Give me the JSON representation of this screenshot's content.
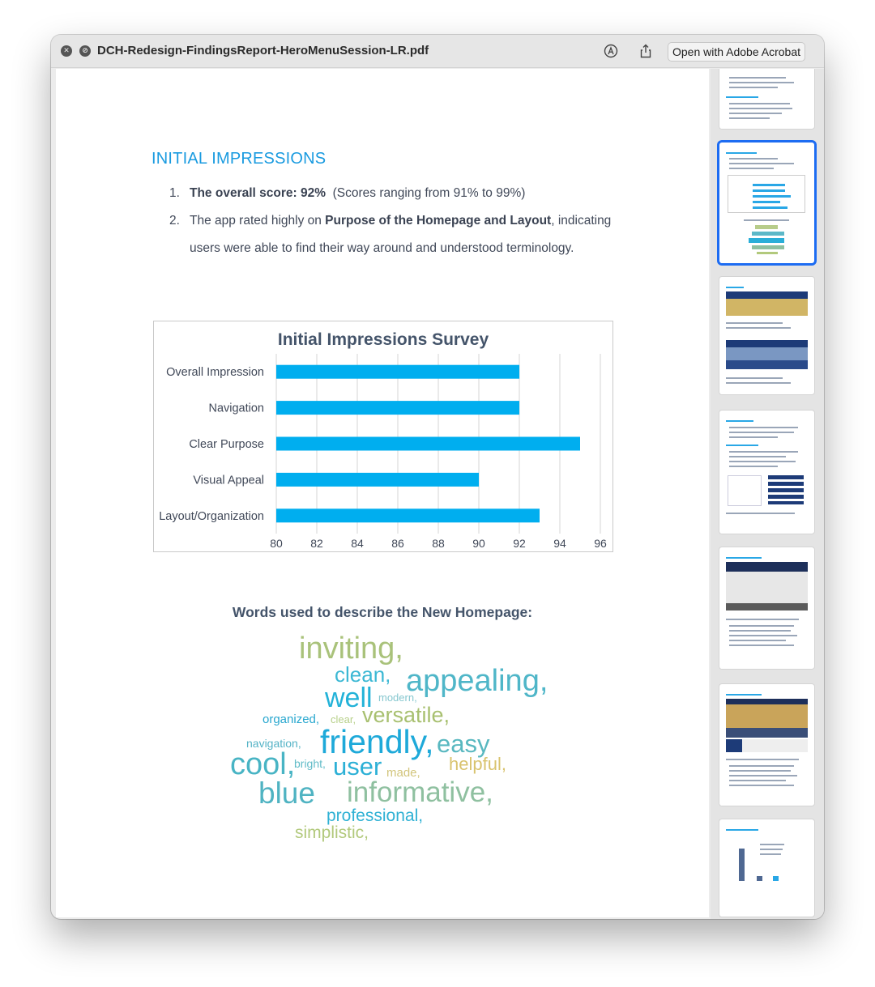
{
  "window": {
    "title": "DCH-Redesign-FindingsReport-HeroMenuSession-LR.pdf",
    "open_button_label": "Open with Adobe Acrobat"
  },
  "document": {
    "section_title": "INITIAL IMPRESSIONS",
    "list": [
      {
        "num": "1.",
        "bold": "The overall score: 92%",
        "rest": "  (Scores ranging from 91% to 99%)"
      },
      {
        "num": "2.",
        "pre": "The app rated highly on ",
        "bold": "Purpose of the Homepage and Layout",
        "post": ", indicating users were able to find their way around and understood terminology."
      }
    ],
    "wordcloud_title": "Words used to describe the New Homepage:",
    "wordcloud": [
      {
        "text": "inviting,",
        "color": "#a9c27a"
      },
      {
        "text": "clean,",
        "color": "#3cb8d4"
      },
      {
        "text": "appealing,",
        "color": "#4fb6c8"
      },
      {
        "text": "well",
        "color": "#22b2d8"
      },
      {
        "text": "modern,",
        "color": "#86c7cf"
      },
      {
        "text": "organized,",
        "color": "#28a7cf"
      },
      {
        "text": "clear,",
        "color": "#b7d08a"
      },
      {
        "text": "versatile,",
        "color": "#a8c070"
      },
      {
        "text": "navigation,",
        "color": "#55b3c6"
      },
      {
        "text": "friendly,",
        "color": "#1ea9d9"
      },
      {
        "text": "easy",
        "color": "#59b8c0"
      },
      {
        "text": "cool,",
        "color": "#48b4c4"
      },
      {
        "text": "bright,",
        "color": "#62bcc8"
      },
      {
        "text": "user",
        "color": "#2cb0d6"
      },
      {
        "text": "made,",
        "color": "#d2c57c"
      },
      {
        "text": "helpful,",
        "color": "#d9c36e"
      },
      {
        "text": "blue",
        "color": "#4fb3c2"
      },
      {
        "text": "informative,",
        "color": "#8fc0a0"
      },
      {
        "text": "professional,",
        "color": "#2fb1d4"
      },
      {
        "text": "simplistic,",
        "color": "#b2c97c"
      }
    ]
  },
  "chart_data": {
    "type": "bar",
    "orientation": "horizontal",
    "title": "Initial Impressions Survey",
    "categories": [
      "Overall Impression",
      "Navigation",
      "Clear Purpose",
      "Visual Appeal",
      "Layout/Organization"
    ],
    "values": [
      92,
      92,
      95,
      90,
      93
    ],
    "xlim": [
      80,
      96
    ],
    "xticks": [
      "80",
      "82",
      "84",
      "86",
      "88",
      "90",
      "92",
      "94",
      "96"
    ],
    "grid": true,
    "bar_color": "#00aeef",
    "legend": "none"
  },
  "sidebar": {
    "selected_page": 2
  }
}
